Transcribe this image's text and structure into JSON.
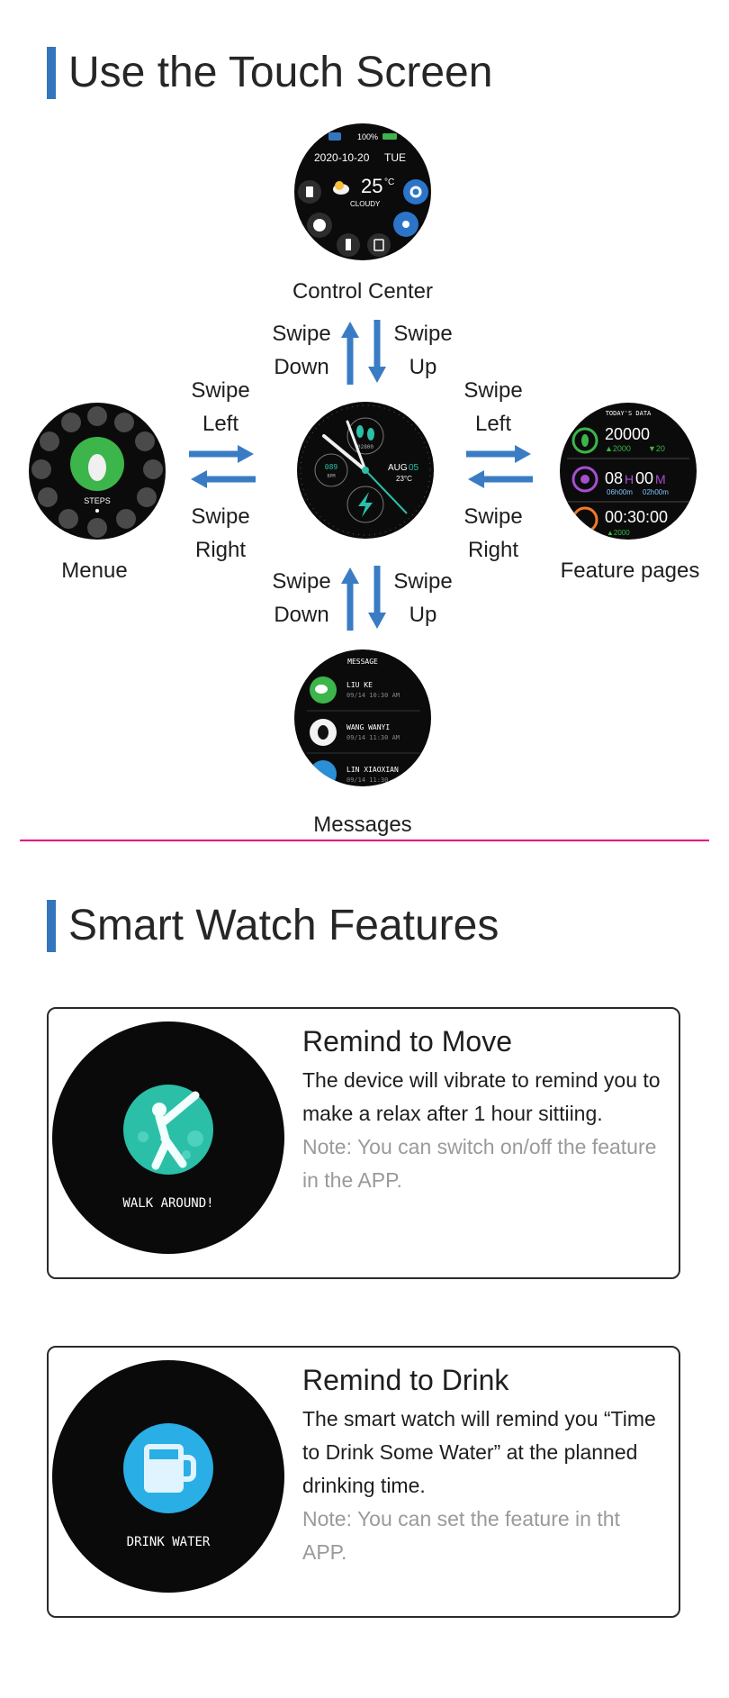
{
  "touch": {
    "title": "Use the Touch Screen",
    "captions": {
      "control_center": "Control Center",
      "menu": "Menue",
      "feature_pages": "Feature pages",
      "messages": "Messages"
    },
    "swipes": {
      "top_left": [
        "Swipe",
        "Down"
      ],
      "top_right": [
        "Swipe",
        "Up"
      ],
      "left_top": [
        "Swipe",
        "Left"
      ],
      "left_bottom": [
        "Swipe",
        "Right"
      ],
      "right_top": [
        "Swipe",
        "Left"
      ],
      "right_bottom": [
        "Swipe",
        "Right"
      ],
      "bottom_left": [
        "Swipe",
        "Down"
      ],
      "bottom_right": [
        "Swipe",
        "Up"
      ]
    },
    "control_screen": {
      "battery": "100%",
      "date": "2020-10-20",
      "day": "TUE",
      "temp": "25",
      "unit": "°C",
      "weather": "CLOUDY"
    },
    "menu_screen": {
      "label": "STEPS"
    },
    "main_screen": {
      "date": "AUG",
      "day_num": "05",
      "temp": "23°C",
      "bpm": "089",
      "bpm_label": "BPM",
      "steps": "02800"
    },
    "feature_screen": {
      "header": "TODAY'S DATA",
      "steps": "20000",
      "up": "▲2000",
      "down": "▼20",
      "sleep_h": "08",
      "sleep_h_unit": "H",
      "sleep_m": "00",
      "sleep_m_unit": "M",
      "sleep_a": "06h00m",
      "sleep_b": "02h00m",
      "timer": "00:30:00",
      "timer_sub": "▲2000"
    },
    "message_screen": {
      "header": "MESSAGE",
      "items": [
        {
          "name": "LIU KE",
          "time": "09/14 10:30 AM"
        },
        {
          "name": "WANG WANYI",
          "time": "09/14 11:30 AM"
        },
        {
          "name": "LIN XIAOXIAN",
          "time": "09/14 11:30"
        }
      ]
    }
  },
  "features": {
    "title": "Smart Watch Features",
    "cards": [
      {
        "title": "Remind to Move",
        "desc": "The device will vibrate to remind you to make a relax after 1 hour sittiing.",
        "note": "Note: You can switch on/off the feature in the APP.",
        "watch_text": "WALK AROUND!"
      },
      {
        "title": "Remind to Drink",
        "desc": "The smart watch will remind you “Time to Drink Some Water” at the planned drinking time.",
        "note": "Note: You can set the feature in tht APP.",
        "watch_text": "DRINK WATER"
      }
    ]
  },
  "colors": {
    "accent": "#3476bd",
    "divider": "#e5007e",
    "arrow": "#3a7cc4",
    "green": "#3cb54a",
    "teal": "#2bbfa8",
    "cyan": "#29aee6"
  }
}
